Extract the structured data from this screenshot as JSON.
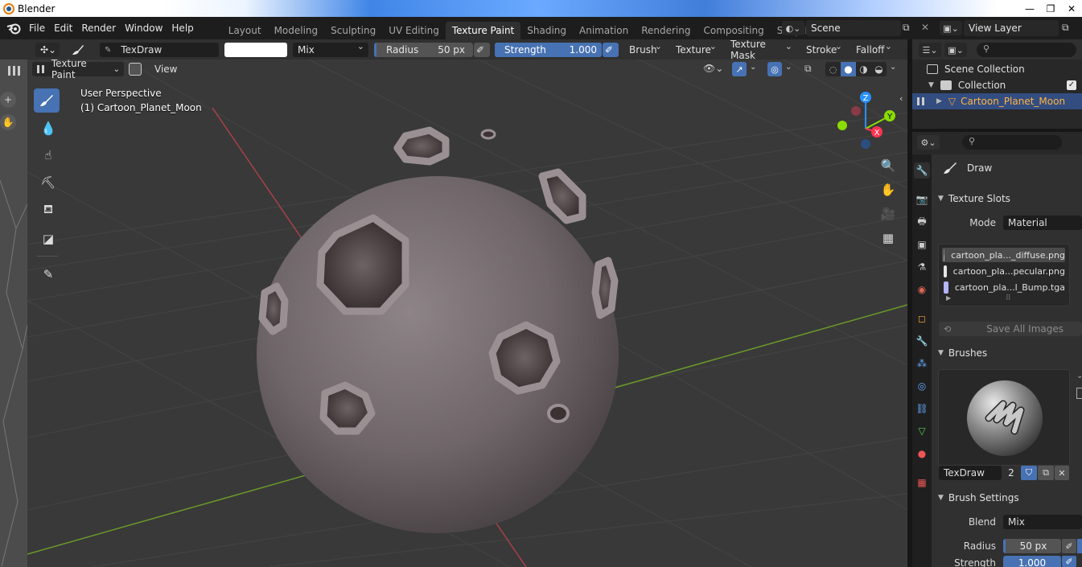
{
  "window": {
    "title": "Blender"
  },
  "menu": {
    "items": [
      "File",
      "Edit",
      "Render",
      "Window",
      "Help"
    ],
    "tabs": [
      "Layout",
      "Modeling",
      "Sculpting",
      "UV Editing",
      "Texture Paint",
      "Shading",
      "Animation",
      "Rendering",
      "Compositing",
      "Scripting"
    ],
    "active_tab": "Texture Paint",
    "add_tab": "+",
    "scene": "Scene",
    "view_layer": "View Layer"
  },
  "tool_header": {
    "brush_name": "TexDraw",
    "blend_mode": "Mix",
    "radius_label": "Radius",
    "radius_value": "50 px",
    "strength_label": "Strength",
    "strength_value": "1.000",
    "strength_fraction": 1.0,
    "brush_menu": "Brush",
    "texture_menu": "Texture",
    "texture_mask_menu": "Texture Mask",
    "stroke_menu": "Stroke",
    "falloff_menu": "Falloff"
  },
  "view_header": {
    "mode": "Texture Paint",
    "view_menu": "View"
  },
  "viewport": {
    "perspective": "User Perspective",
    "object_label": "(1) Cartoon_Planet_Moon",
    "gizmo": {
      "x": "X",
      "y": "Y",
      "z": "Z"
    },
    "colors": {
      "x_axis": "#ff3352",
      "y_axis": "#8bdc00",
      "z_axis": "#2890ff",
      "background": "#393939"
    }
  },
  "outliner": {
    "scene_collection": "Scene Collection",
    "collection": "Collection",
    "object": "Cartoon_Planet_Moon"
  },
  "properties": {
    "tool_name": "Draw",
    "texture_slots": {
      "title": "Texture Slots",
      "mode_label": "Mode",
      "mode_value": "Material",
      "slots": [
        {
          "name": "cartoon_pla..._diffuse.png",
          "swatch": "#8c7c80",
          "selected": true
        },
        {
          "name": "cartoon_pla...pecular.png",
          "swatch": "#e6e6e6",
          "selected": false
        },
        {
          "name": "cartoon_pla...l_Bump.tga",
          "swatch": "#b4b4ff",
          "selected": false
        }
      ],
      "save_all": "Save All Images"
    },
    "brushes": {
      "title": "Brushes",
      "name": "TexDraw",
      "users": "2"
    },
    "brush_settings": {
      "title": "Brush Settings",
      "blend_label": "Blend",
      "blend_value": "Mix",
      "radius_label": "Radius",
      "radius_value": "50 px",
      "strength_label": "Strength",
      "strength_value": "1.000"
    }
  }
}
